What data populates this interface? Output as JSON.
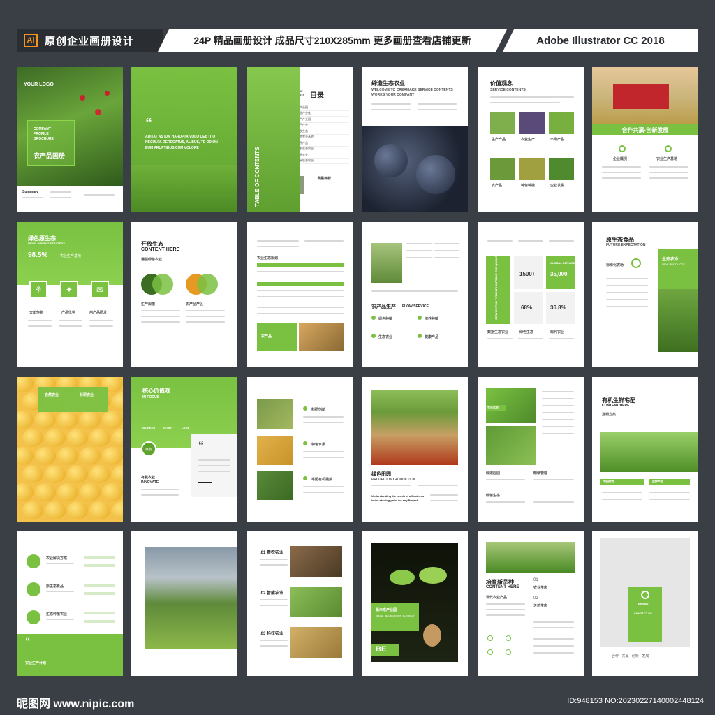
{
  "header": {
    "ai_badge": "Ai",
    "left_title": "原创企业画册设计",
    "center_title": "24P 精品画册设计 成品尺寸210X285mm 更多画册查看店铺更新",
    "right_title": "Adobe Illustrator CC 2018"
  },
  "pages": {
    "p1": {
      "logo": "YOUR LOGO",
      "line1": "COMPANY",
      "line2": "PROFILE",
      "line3": "BROCHURE",
      "cn": "农产品画册",
      "summary": "Summary"
    },
    "p2": {
      "quote": "ADITAT AS IUM HARUPTA VOLO DEB ITIO NECULPA DERECATUS, ALIBUS, TE ODION EUM ARUPTIBUS CUM VOLORE"
    },
    "p3": {
      "vertical": "TABLE OF CONTENTS"
    },
    "p4": {
      "en": "TABLE OF CONTENTS",
      "cn": "目录",
      "items": [
        "当产业园",
        "农业产业化",
        "生产产业园",
        "绿色产业",
        "开发生态",
        "生态农业基地",
        "天然产品",
        "开发生态农业",
        "科研农业",
        "共享生态农业"
      ],
      "target": "发展目标"
    },
    "p5": {
      "cn": "缔造生态农业",
      "en1": "WELCOME TO CREAMAKE SERVICE CONTENTS",
      "en2": "WORKS YOUR COMPANY"
    },
    "p6": {
      "cn": "价值观念",
      "en": "SERVICE CONTENTS",
      "labels": [
        "生产产品",
        "农业生产",
        "市场产品",
        "农产品",
        "特色种植",
        "企业发展"
      ]
    },
    "p7": {
      "banner": "合作共赢·创新发展",
      "col1": "企业概况",
      "col2": "农业生产基地"
    },
    "p8": {
      "cn": "绿色原生态",
      "en": "DEVELOPMENT STRATEGY",
      "pct": "98.5%",
      "pct_label": "农业生产基地",
      "icons": [
        "大田作物",
        "产品优势",
        "用产品研发"
      ]
    },
    "p9": {
      "cn": "开放生态",
      "en": "CONTENT HERE",
      "sub": "遵循绿色农业",
      "l1": "生产规模",
      "l2": "农产品产区"
    },
    "p10": {
      "table_title": "农业生态规划",
      "footer": "农产品"
    },
    "p11": {
      "title_cn": "农产品生产",
      "title_en": "FLOW SERVICE",
      "items": [
        "绿色种植",
        "培养种植",
        "生态农业",
        "健康产品"
      ]
    },
    "p12": {
      "vertical": "SERVICE FOR PATIENTS IMPROVE THE QUALITY OF LIFE",
      "stat1": "1500+",
      "stat2": "35,000",
      "stat3": "68%",
      "stat4": "36.8%",
      "global": "GLOBAL SERVICES",
      "labels": [
        "数据生态农业",
        "绿色生态",
        "现代农业"
      ]
    },
    "p13": {
      "cn": "原生态食品",
      "en": "FUTURE EXPECTATION",
      "std": "标准化农场",
      "box_cn": "生态农业",
      "box_en": "NEW PRODUCTS"
    },
    "p14": {
      "tag1": "自然农业",
      "tag2": "科研农业"
    },
    "p15": {
      "cn": "核心价值观",
      "en": "IN FOCUS",
      "w1": "WORKER",
      "w2": "STUDY",
      "w3": "CARE",
      "tag": "目标",
      "sub1": "有机农业",
      "sub2": "INNOVATE"
    },
    "p16": {
      "items": [
        "科研创新",
        "特色水果",
        "宅配有机蔬菜"
      ]
    },
    "p17": {
      "cn": "绿色田园",
      "en": "PROJECT INTRODUCTION",
      "slogan": "Understanding the needs of a Business is the starting point for any Project"
    },
    "p18": {
      "tag": "农业生态",
      "l1": "绿道园园",
      "l2": "精细管理",
      "l3": "绿色生态"
    },
    "p19": {
      "cn": "有机生鲜宅配",
      "en": "CONTENT HERE",
      "sub": "直销方案",
      "t1": "宅配优势",
      "t2": "生鲜产品"
    },
    "p20": {
      "items": [
        "农业解决方案",
        "原生态食品",
        "生态种植农业"
      ],
      "footer": "农业生产计划"
    },
    "p21": {},
    "p22": {
      "items": [
        ".01 新农农业",
        ".02 智能农业",
        ".03 科技农业"
      ]
    },
    "p23": {
      "cn": "新未来产业园",
      "sub": "ONLINE, RELUMNAR RUN, PLAYRIGHT",
      "be": "BE"
    },
    "p24": {
      "cn": "培育新品种",
      "en": "CONTENT HERE",
      "sub": "现代农业产品",
      "l1": "农业生态",
      "l2": "天然生态",
      "n1": "01",
      "n2": "02"
    },
    "p25": {
      "brand": "BRAND",
      "contact": "CONTACT US",
      "footer": "合作 · 共赢 · 创新 · 发展"
    }
  },
  "footer": {
    "logo": "昵图网 www.nipic.com",
    "id": "ID:948153 NO:20230227140002448124"
  }
}
